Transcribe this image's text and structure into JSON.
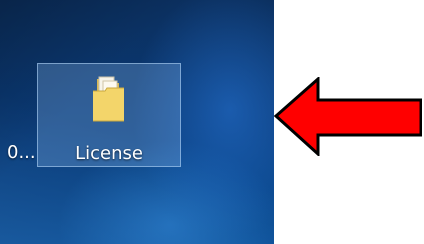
{
  "desktop": {
    "icons": [
      {
        "label": "License",
        "icon": "folder-icon",
        "selected": true
      }
    ],
    "partial_label": "0..."
  },
  "annotation": {
    "arrow_icon": "arrow-left-icon",
    "fill_color": "#ff0000",
    "outline_color": "#000000"
  }
}
